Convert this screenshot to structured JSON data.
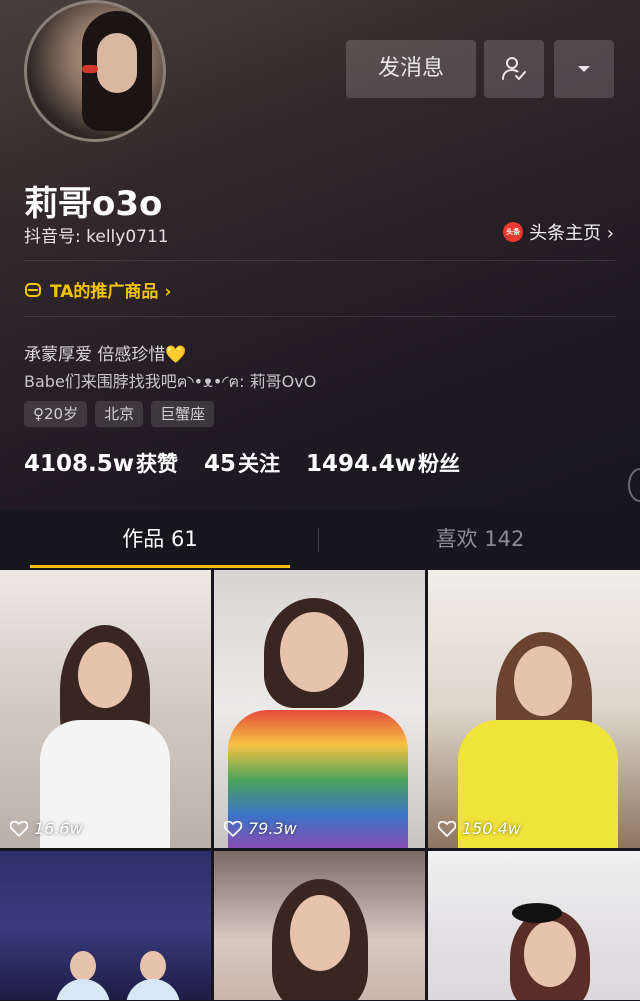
{
  "profile": {
    "name": "莉哥o3o",
    "douyin_id": "抖音号: kelly0711",
    "toutiao_logo": "头条",
    "toutiao_label": "头条主页 ›",
    "promo_label": "TA的推广商品 ›",
    "bio_line1": "承蒙厚爱 倍感珍惜💛",
    "bio_line2": "Babe们来围脖找我吧ฅ◝•ᴥ•◜ฅ: 莉哥OvO",
    "tags": [
      "♀20岁",
      "北京",
      "巨蟹座"
    ]
  },
  "actions": {
    "message_label": "发消息"
  },
  "stats": [
    {
      "value": "4108.5w",
      "label": "获赞"
    },
    {
      "value": "45",
      "label": "关注"
    },
    {
      "value": "1494.4w",
      "label": "粉丝"
    }
  ],
  "tabs": [
    {
      "label": "作品 61",
      "active": true
    },
    {
      "label": "喜欢 142",
      "active": false
    }
  ],
  "videos": [
    {
      "likes": "16.6w"
    },
    {
      "likes": "79.3w"
    },
    {
      "likes": "150.4w"
    },
    {
      "likes": ""
    },
    {
      "likes": ""
    },
    {
      "likes": ""
    }
  ],
  "colors": {
    "accent": "#f5c400",
    "background": "#17161d"
  }
}
